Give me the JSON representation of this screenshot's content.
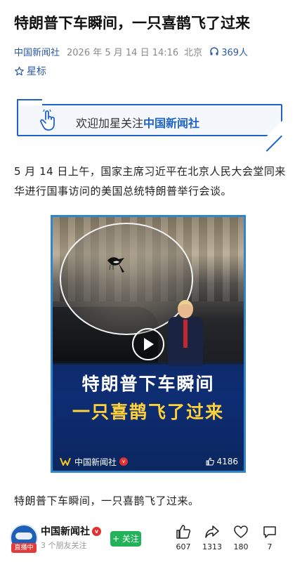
{
  "article": {
    "title": "特朗普下车瞬间，一只喜鹊飞了过来",
    "source": "中国新闻社",
    "date": "2026 年 5 月 14 日 14:16",
    "location": "北京",
    "listen_count": "369人",
    "star_label": "星标"
  },
  "banner": {
    "prefix": "欢迎加星关注",
    "brand": "中国新闻社"
  },
  "body": {
    "paragraph": "5 月 14 日上午，国家主席习近平在北京人民大会堂同来华进行国事访问的美国总统特朗普举行会谈。",
    "caption": "特朗普下车瞬间，一只喜鹊飞了过来。"
  },
  "video": {
    "caption_line1": "特朗普下车瞬间",
    "caption_line2": "一只喜鹊飞了过来",
    "channel": "中国新闻社",
    "likes": "4186"
  },
  "account": {
    "name": "中国新闻社",
    "live_badge": "直播中",
    "friends_following": "3 个朋友关注",
    "follow_label": "+ 关注"
  },
  "actions": {
    "like_count": "607",
    "share_count": "1313",
    "favorite_count": "180",
    "comment_count": "7"
  },
  "colors": {
    "brand_blue": "#1f63c6",
    "link_blue": "#2b5aa8",
    "follow_green": "#22b25a",
    "live_red": "#e23b3b",
    "caption_yellow": "#ffd23a"
  }
}
